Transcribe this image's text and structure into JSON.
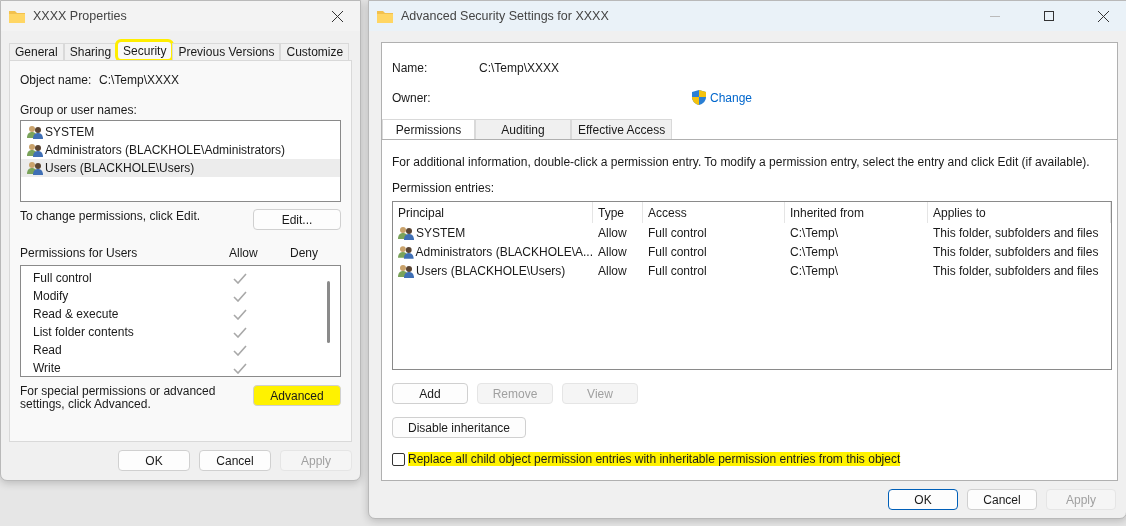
{
  "properties_window": {
    "title": "XXXX Properties",
    "tabs": [
      {
        "label": "General",
        "selected": false,
        "highlighted": false
      },
      {
        "label": "Sharing",
        "selected": false,
        "highlighted": false
      },
      {
        "label": "Security",
        "selected": true,
        "highlighted": true
      },
      {
        "label": "Previous Versions",
        "selected": false,
        "highlighted": false
      },
      {
        "label": "Customize",
        "selected": false,
        "highlighted": false
      }
    ],
    "object_name_label": "Object name:",
    "object_name": "C:\\Temp\\XXXX",
    "group_label": "Group or user names:",
    "groups": [
      {
        "name": "SYSTEM",
        "selected": false
      },
      {
        "name": "Administrators (BLACKHOLE\\Administrators)",
        "selected": false
      },
      {
        "name": "Users (BLACKHOLE\\Users)",
        "selected": true
      }
    ],
    "edit_hint": "To change permissions, click Edit.",
    "edit_button": "Edit...",
    "permissions_label": "Permissions for Users",
    "allow_header": "Allow",
    "deny_header": "Deny",
    "permissions": [
      {
        "name": "Full control",
        "allow": true,
        "deny": false
      },
      {
        "name": "Modify",
        "allow": true,
        "deny": false
      },
      {
        "name": "Read & execute",
        "allow": true,
        "deny": false
      },
      {
        "name": "List folder contents",
        "allow": true,
        "deny": false
      },
      {
        "name": "Read",
        "allow": true,
        "deny": false
      },
      {
        "name": "Write",
        "allow": true,
        "deny": false
      }
    ],
    "advanced_hint": "For special permissions or advanced settings, click Advanced.",
    "advanced_button": {
      "label": "Advanced",
      "highlighted": true
    },
    "buttons": [
      {
        "label": "OK",
        "disabled": false
      },
      {
        "label": "Cancel",
        "disabled": false
      },
      {
        "label": "Apply",
        "disabled": true
      }
    ]
  },
  "advanced_window": {
    "title": "Advanced Security Settings for XXXX",
    "name_label": "Name:",
    "name": "C:\\Temp\\XXXX",
    "owner_label": "Owner:",
    "change_link": "Change",
    "tabs": [
      {
        "label": "Permissions",
        "selected": true
      },
      {
        "label": "Auditing",
        "selected": false
      },
      {
        "label": "Effective Access",
        "selected": false
      }
    ],
    "info": "For additional information, double-click a permission entry. To modify a permission entry, select the entry and click Edit (if available).",
    "entries_label": "Permission entries:",
    "table": {
      "columns": [
        "Principal",
        "Type",
        "Access",
        "Inherited from",
        "Applies to"
      ],
      "rows": [
        [
          "SYSTEM",
          "Allow",
          "Full control",
          "C:\\Temp\\",
          "This folder, subfolders and files"
        ],
        [
          "Administrators (BLACKHOLE\\A...",
          "Allow",
          "Full control",
          "C:\\Temp\\",
          "This folder, subfolders and files"
        ],
        [
          "Users (BLACKHOLE\\Users)",
          "Allow",
          "Full control",
          "C:\\Temp\\",
          "This folder, subfolders and files"
        ]
      ]
    },
    "entry_buttons": [
      {
        "label": "Add",
        "disabled": false
      },
      {
        "label": "Remove",
        "disabled": true
      },
      {
        "label": "View",
        "disabled": true
      }
    ],
    "disable_inheritance": "Disable inheritance",
    "replace_checkbox": {
      "label": "Replace all child object permission entries with inheritable permission entries from this object",
      "checked": false,
      "highlighted": true
    },
    "buttons": [
      {
        "label": "OK",
        "disabled": false
      },
      {
        "label": "Cancel",
        "disabled": false
      },
      {
        "label": "Apply",
        "disabled": true
      }
    ]
  }
}
